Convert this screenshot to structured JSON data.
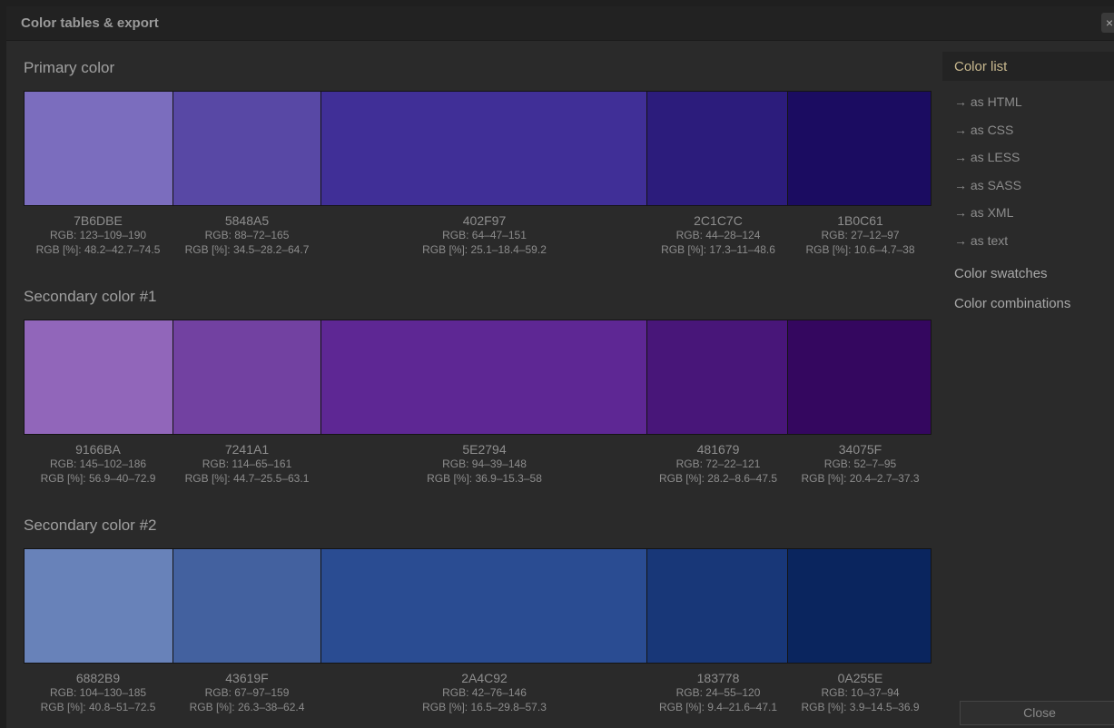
{
  "window": {
    "title": "Color tables & export",
    "close_glyph": "×"
  },
  "sections": [
    {
      "title": "Primary color",
      "swatches": [
        {
          "hex": "7B6DBE",
          "rgb": "RGB: 123–109–190",
          "pct": "RGB [%]: 48.2–42.7–74.5",
          "color": "#7B6DBE"
        },
        {
          "hex": "5848A5",
          "rgb": "RGB: 88–72–165",
          "pct": "RGB [%]: 34.5–28.2–64.7",
          "color": "#5848A5"
        },
        {
          "hex": "402F97",
          "rgb": "RGB: 64–47–151",
          "pct": "RGB [%]: 25.1–18.4–59.2",
          "color": "#402F97"
        },
        {
          "hex": "2C1C7C",
          "rgb": "RGB: 44–28–124",
          "pct": "RGB [%]: 17.3–11–48.6",
          "color": "#2C1C7C"
        },
        {
          "hex": "1B0C61",
          "rgb": "RGB: 27–12–97",
          "pct": "RGB [%]: 10.6–4.7–38",
          "color": "#1B0C61"
        }
      ]
    },
    {
      "title": "Secondary color #1",
      "swatches": [
        {
          "hex": "9166BA",
          "rgb": "RGB: 145–102–186",
          "pct": "RGB [%]: 56.9–40–72.9",
          "color": "#9166BA"
        },
        {
          "hex": "7241A1",
          "rgb": "RGB: 114–65–161",
          "pct": "RGB [%]: 44.7–25.5–63.1",
          "color": "#7241A1"
        },
        {
          "hex": "5E2794",
          "rgb": "RGB: 94–39–148",
          "pct": "RGB [%]: 36.9–15.3–58",
          "color": "#5E2794"
        },
        {
          "hex": "481679",
          "rgb": "RGB: 72–22–121",
          "pct": "RGB [%]: 28.2–8.6–47.5",
          "color": "#481679"
        },
        {
          "hex": "34075F",
          "rgb": "RGB: 52–7–95",
          "pct": "RGB [%]: 20.4–2.7–37.3",
          "color": "#34075F"
        }
      ]
    },
    {
      "title": "Secondary color #2",
      "swatches": [
        {
          "hex": "6882B9",
          "rgb": "RGB: 104–130–185",
          "pct": "RGB [%]: 40.8–51–72.5",
          "color": "#6882B9"
        },
        {
          "hex": "43619F",
          "rgb": "RGB: 67–97–159",
          "pct": "RGB [%]: 26.3–38–62.4",
          "color": "#43619F"
        },
        {
          "hex": "2A4C92",
          "rgb": "RGB: 42–76–146",
          "pct": "RGB [%]: 16.5–29.8–57.3",
          "color": "#2A4C92"
        },
        {
          "hex": "183778",
          "rgb": "RGB: 24–55–120",
          "pct": "RGB [%]: 9.4–21.6–47.1",
          "color": "#183778"
        },
        {
          "hex": "0A255E",
          "rgb": "RGB: 10–37–94",
          "pct": "RGB [%]: 3.9–14.5–36.9",
          "color": "#0A255E"
        }
      ]
    }
  ],
  "sidebar": {
    "heading": "Color list",
    "export_items": [
      "→ as HTML",
      "→ as CSS",
      "→ as LESS",
      "→ as SASS",
      "→ as XML",
      "→ as text"
    ],
    "links": [
      "Color swatches",
      "Color combinations"
    ]
  },
  "footer": {
    "close_label": "Close"
  }
}
